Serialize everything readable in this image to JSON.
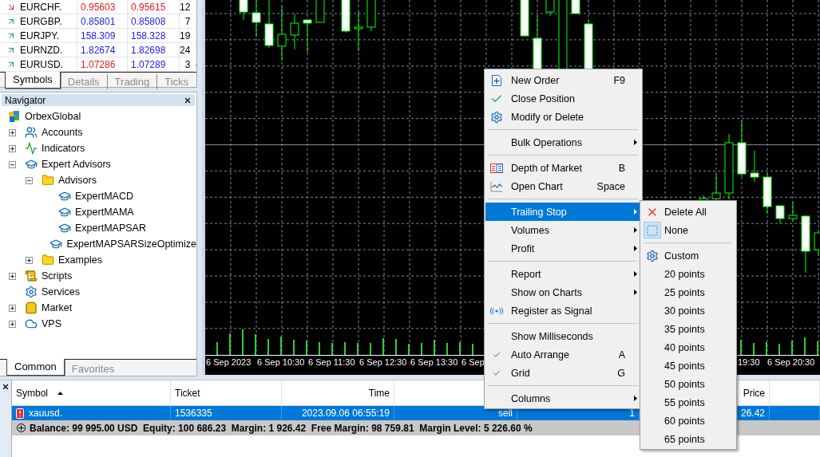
{
  "market_watch": {
    "rows": [
      {
        "symbol": "EURCHF.",
        "rising": false,
        "bid": {
          "value": "0.95603",
          "rising": false
        },
        "ask": {
          "value": "0.95615",
          "rising": false
        },
        "spread": "12"
      },
      {
        "symbol": "EURGBP.",
        "rising": true,
        "bid": {
          "value": "0.85801",
          "rising": true
        },
        "ask": {
          "value": "0.85808",
          "rising": true
        },
        "spread": "7"
      },
      {
        "symbol": "EURJPY.",
        "rising": true,
        "bid": {
          "value": "158.309",
          "rising": true
        },
        "ask": {
          "value": "158.328",
          "rising": true
        },
        "spread": "19"
      },
      {
        "symbol": "EURNZD.",
        "rising": true,
        "bid": {
          "value": "1.82674",
          "rising": true
        },
        "ask": {
          "value": "1.82698",
          "rising": true
        },
        "spread": "24"
      },
      {
        "symbol": "EURUSD.",
        "rising": true,
        "bid": {
          "value": "1.07286",
          "rising": false
        },
        "ask": {
          "value": "1.07289",
          "rising": true
        },
        "spread": "3"
      }
    ],
    "tabs": [
      {
        "label": "Symbols",
        "selected": true
      },
      {
        "label": "Details",
        "selected": false
      },
      {
        "label": "Trading",
        "selected": false
      },
      {
        "label": "Ticks",
        "selected": false
      }
    ]
  },
  "navigator": {
    "title": "Navigator",
    "tree": {
      "label": "OrbexGlobal",
      "kind": "broker",
      "children": [
        {
          "label": "Accounts",
          "kind": "accounts",
          "expanded": false
        },
        {
          "label": "Indicators",
          "kind": "indicators",
          "expanded": false
        },
        {
          "label": "Expert Advisors",
          "kind": "experts",
          "expanded": true,
          "children": [
            {
              "label": "Advisors",
              "kind": "folder",
              "expanded": true,
              "children": [
                {
                  "label": "ExpertMACD",
                  "kind": "expert"
                },
                {
                  "label": "ExpertMAMA",
                  "kind": "expert"
                },
                {
                  "label": "ExpertMAPSAR",
                  "kind": "expert"
                },
                {
                  "label": "ExpertMAPSARSizeOptimize",
                  "kind": "expert"
                }
              ]
            },
            {
              "label": "Examples",
              "kind": "folder",
              "expanded": false
            }
          ]
        },
        {
          "label": "Scripts",
          "kind": "scripts",
          "expanded": false
        },
        {
          "label": "Services",
          "kind": "services"
        },
        {
          "label": "Market",
          "kind": "market",
          "expanded": false
        },
        {
          "label": "VPS",
          "kind": "vps",
          "expanded": false
        }
      ]
    },
    "tabs": [
      {
        "label": "Common",
        "selected": true
      },
      {
        "label": "Favorites",
        "selected": false
      }
    ]
  },
  "chart": {
    "time_labels": [
      "6 Sep 2023",
      "6 Sep 10:30",
      "6 Sep 11:30",
      "6 Sep 12:30",
      "6 Sep 13:30",
      "6 Sep",
      "19:30",
      "6 Sep 20:30"
    ]
  },
  "terminal": {
    "columns": [
      {
        "label": "Symbol",
        "sorted": true
      },
      {
        "label": "Ticket",
        "sorted": false
      },
      {
        "label": "Time",
        "sorted": false
      },
      {},
      {},
      {},
      {
        "label": "Price",
        "sorted": false
      }
    ],
    "rows": [
      {
        "selected": true,
        "cells": [
          "xauusd.",
          "1536335",
          "2023.09.06 06:55:19",
          "sell",
          "1",
          "",
          "26.42"
        ]
      }
    ],
    "summary": "Balance: 99 995.00 USD  Equity: 100 686.23  Margin: 1 926.42  Free Margin: 98 759.81  Margin Level: 5 226.60 %"
  },
  "context_menu": {
    "groups": [
      [
        {
          "label": "New Order",
          "kind": "order",
          "shortcut": "F9",
          "submenu": false,
          "checked": false,
          "selected": false
        },
        {
          "label": "Close Position",
          "kind": "close",
          "submenu": false,
          "checked": false,
          "selected": false
        },
        {
          "label": "Modify or Delete",
          "kind": "modify",
          "submenu": false,
          "checked": false,
          "selected": false
        }
      ],
      [
        {
          "label": "Bulk Operations",
          "kind": "plain",
          "submenu": true,
          "checked": false,
          "selected": false
        }
      ],
      [
        {
          "label": "Depth of Market",
          "kind": "depth",
          "shortcut": "B",
          "submenu": false,
          "checked": false,
          "selected": false
        },
        {
          "label": "Open Chart",
          "kind": "chart",
          "shortcut": "Space",
          "submenu": false,
          "checked": false,
          "selected": false
        }
      ],
      [
        {
          "label": "Trailing Stop",
          "kind": "plain",
          "submenu": true,
          "checked": false,
          "selected": true
        },
        {
          "label": "Volumes",
          "kind": "plain",
          "submenu": true,
          "checked": false,
          "selected": false
        },
        {
          "label": "Profit",
          "kind": "plain",
          "submenu": true,
          "checked": false,
          "selected": false
        }
      ],
      [
        {
          "label": "Report",
          "kind": "plain",
          "submenu": true,
          "checked": false,
          "selected": false
        },
        {
          "label": "Show on Charts",
          "kind": "plain",
          "submenu": true,
          "checked": false,
          "selected": false
        },
        {
          "label": "Register as Signal",
          "kind": "signal",
          "submenu": false,
          "checked": false,
          "selected": false
        }
      ],
      [
        {
          "label": "Show Milliseconds",
          "kind": "plain",
          "submenu": false,
          "checked": false,
          "selected": false
        },
        {
          "label": "Auto Arrange",
          "kind": "plain",
          "shortcut": "A",
          "submenu": false,
          "checked": true,
          "selected": false
        },
        {
          "label": "Grid",
          "kind": "plain",
          "shortcut": "G",
          "submenu": false,
          "checked": true,
          "selected": false
        }
      ],
      [
        {
          "label": "Columns",
          "kind": "plain",
          "submenu": true,
          "checked": false,
          "selected": false
        }
      ]
    ]
  },
  "trailing_stop_menu": {
    "groups": [
      [
        {
          "label": "Delete All",
          "kind": "delete",
          "checked": false
        },
        {
          "label": "None",
          "kind": "none",
          "checked": true
        }
      ],
      [
        {
          "label": "Custom",
          "kind": "custom",
          "checked": false
        },
        {
          "label": "20 points",
          "kind": "plain",
          "checked": false
        },
        {
          "label": "25 points",
          "kind": "plain",
          "checked": false
        },
        {
          "label": "30 points",
          "kind": "plain",
          "checked": false
        },
        {
          "label": "35 points",
          "kind": "plain",
          "checked": false
        },
        {
          "label": "40 points",
          "kind": "plain",
          "checked": false
        },
        {
          "label": "45 points",
          "kind": "plain",
          "checked": false
        },
        {
          "label": "50 points",
          "kind": "plain",
          "checked": false
        },
        {
          "label": "55 points",
          "kind": "plain",
          "checked": false
        },
        {
          "label": "60 points",
          "kind": "plain",
          "checked": false
        },
        {
          "label": "65 points",
          "kind": "plain",
          "checked": false
        }
      ]
    ]
  }
}
